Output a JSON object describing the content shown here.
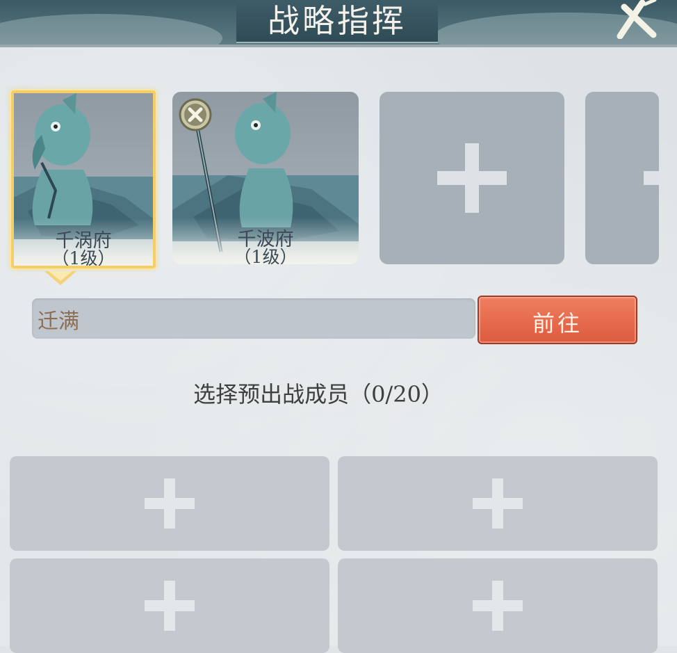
{
  "header": {
    "title": "战略指挥"
  },
  "formations": [
    {
      "name": "千涡府",
      "level": "（1级）",
      "selected": true
    },
    {
      "name": "千波府",
      "level": "（1级）",
      "selected": false
    }
  ],
  "input": {
    "value": "迁满"
  },
  "actions": {
    "go_label": "前往"
  },
  "members": {
    "label": "选择预出战成员（0/20）"
  },
  "colors": {
    "accent_gold": "#f4cf69",
    "button_red": "#e0603f",
    "panel_bg": "#dfe4e7"
  },
  "icons": [
    "close-icon",
    "remove-icon",
    "plus-icon",
    "pointer-arrow-icon"
  ]
}
